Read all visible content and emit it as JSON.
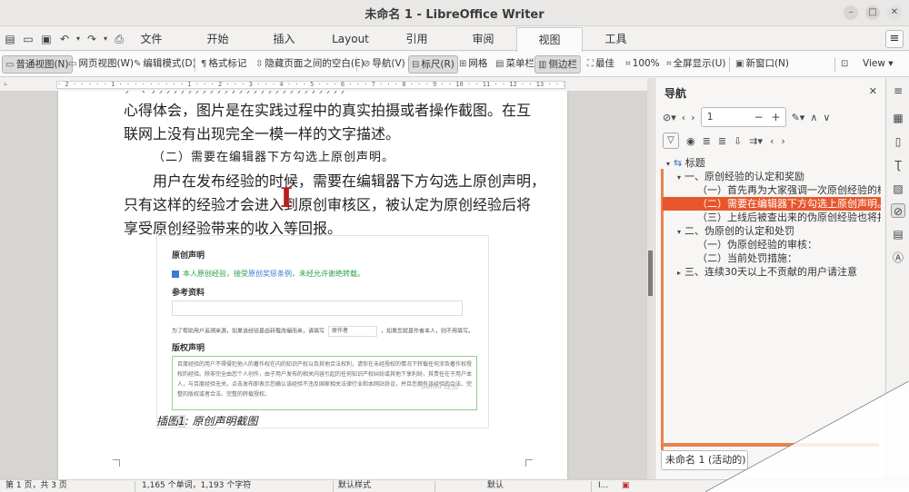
{
  "window": {
    "title": "未命名 1 - LibreOffice Writer"
  },
  "tabs": [
    "文件",
    "开始",
    "插入",
    "Layout",
    "引用",
    "审阅",
    "视图",
    "工具"
  ],
  "active_tab": "视图",
  "ribbon": {
    "normal_view": "普通视图(N)",
    "web_view": "网页视图(W)",
    "edit_mode": "编辑模式(D)",
    "formatting_marks": "格式标记",
    "hide_whitespace": "隐藏页面之间的空白(E)",
    "navigator": "导航(V)",
    "ruler": "标尺(R)",
    "grid": "网格",
    "menubar": "菜单栏",
    "sidebar": "侧边栏",
    "optimal": "最佳",
    "zoom_100": "100%",
    "fullscreen": "全屏显示(U)",
    "new_window": "新窗口(N)",
    "view_menu": "View"
  },
  "ruler": {
    "marks": "· 2 · · · · · 1 · · · · · · · · · 1 · · · 2 · · · 3 · · · 4 · · · 5 · · · 6 · · · 7 · · · 8 · · · 9 · · 10 · · 11 · · 12 · · 13 · · 14 · · 15 · · 16 · · 17 · · 18"
  },
  "document": {
    "partial_top": "，（    ，，，，，，，，，，，，，，，，，，，，，，，，，，，",
    "line1": "心得体会，图片是在实践过程中的真实拍摄或者操作截图。在互",
    "line2": "联网上没有出现完全一模一样的文字描述。",
    "heading": "（二）需要在编辑器下方勾选上原创声明。",
    "para2_line1": "用户在发布经验的时候，需要在编辑器下方勾选上原创声明，",
    "para2_line2": "只有这样的经验才会进入到原创审核区，被认定为原创经验后将",
    "para2_line3": "享受原创经验带来的收入等回报。",
    "caption_label": "插图",
    "caption_num": "1",
    "caption_text": ": 原创声明截图"
  },
  "embedded_image": {
    "section1": "原创声明",
    "checkbox_text": "本人原创经验，接受",
    "checkbox_link": "原创奖惩条例",
    "checkbox_rest": "，未经允许谢绝转载。",
    "section2": "参考资料",
    "small_text": "为了帮助用户追溯来源，如果该经验是由转载改编而来，请填写",
    "small_field": "原作者",
    "small_text2": "，如果您就是作者本人，则不用填写。",
    "section3": "版权声明",
    "copyright_text": "百度经验的用户不得侵犯他人的著作权在内的知识产权以及其他合法权利，请你在未经授权的情况下转载任何涉及著作权授权的经验。除非完全由您个人创作，由于用户发布的相关内容引起的任何知识产权纠纷或其他下享利纷，其责任在于用户本人，与百度经验无关。点击发布即表示您确认该经验不违反国家相关法律行业和本网站协议，并且您拥有该经验的合法、完整的版权或者合法、完整的转载授权。",
    "watermark": "Baidu 经验"
  },
  "navigator": {
    "title": "导航",
    "page_value": "1",
    "tree": [
      {
        "label": "标题",
        "level": 0,
        "arrow": "▾",
        "prefix": "⇆"
      },
      {
        "label": "一、原创经验的认定和奖励",
        "level": 1,
        "arrow": "▾"
      },
      {
        "label": "（一）首先再为大家强调一次原创经验的概",
        "level": 2,
        "arrow": ""
      },
      {
        "label": "（二）需要在编辑器下方勾选上原创声明。",
        "level": 2,
        "arrow": "",
        "selected": true
      },
      {
        "label": "（三）上线后被查出来的伪原创经验也将扣",
        "level": 2,
        "arrow": ""
      },
      {
        "label": "二、伪原创的认定和处罚",
        "level": 1,
        "arrow": "▾"
      },
      {
        "label": "（一）伪原创经验的审核：",
        "level": 2,
        "arrow": ""
      },
      {
        "label": "（二）当前处罚措施：",
        "level": 2,
        "arrow": ""
      },
      {
        "label": "三、连续30天以上不贡献的用户请注意",
        "level": 1,
        "arrow": "▸"
      }
    ],
    "document_list": "未命名 1 (活动的)"
  },
  "statusbar": {
    "page": "第 1 页，共 3 页",
    "words": "1,165 个单词，1,193 个字符",
    "style": "默认样式",
    "language": "默认",
    "insert_mode": "I..."
  },
  "colors": {
    "accent": "#e9552b",
    "sidebar_accent": "#e8834e",
    "cursor": "#b81e1e"
  }
}
